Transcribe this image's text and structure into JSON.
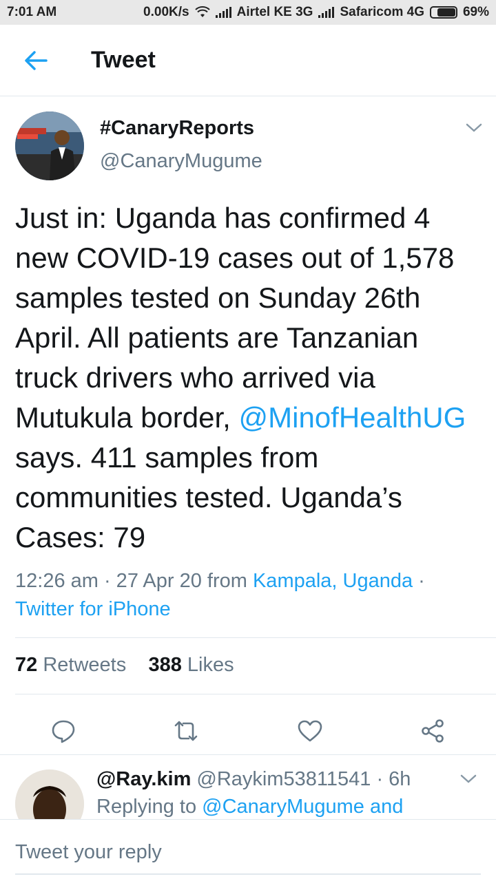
{
  "status_bar": {
    "time": "7:01 AM",
    "speed": "0.00K/s",
    "carrier1": "Airtel KE 3G",
    "carrier2": "Safaricom 4G",
    "battery": "69%"
  },
  "header": {
    "title": "Tweet"
  },
  "tweet": {
    "display_name": "#CanaryReports",
    "handle": "@CanaryMugume",
    "text_before_mention": "Just in: Uganda has confirmed 4 new COVID-19 cases out of 1,578 samples tested on Sunday 26th April. All patients are Tanzanian truck drivers who arrived via Mutukula border, ",
    "mention": "@MinofHealthUG",
    "text_after_mention": " says. 411 samples from communities tested. Uganda’s Cases: 79",
    "time": "12:26 am · 27 Apr 20 from ",
    "location": "Kampala, Uganda",
    "location_sep": " ·",
    "source": "Twitter for iPhone",
    "retweet_count": "72",
    "retweets_label": "Retweets",
    "like_count": "388",
    "likes_label": "Likes"
  },
  "reply": {
    "display_name": "@Ray.kim",
    "handle_time": " @Raykim53811541 · 6h",
    "replying_to_label": "Replying to ",
    "replying_to_link": "@CanaryMugume and"
  },
  "compose": {
    "placeholder": "Tweet your reply"
  },
  "colors": {
    "accent": "#1da1f2",
    "secondary_text": "#657786",
    "divider": "#e1e8ed"
  }
}
